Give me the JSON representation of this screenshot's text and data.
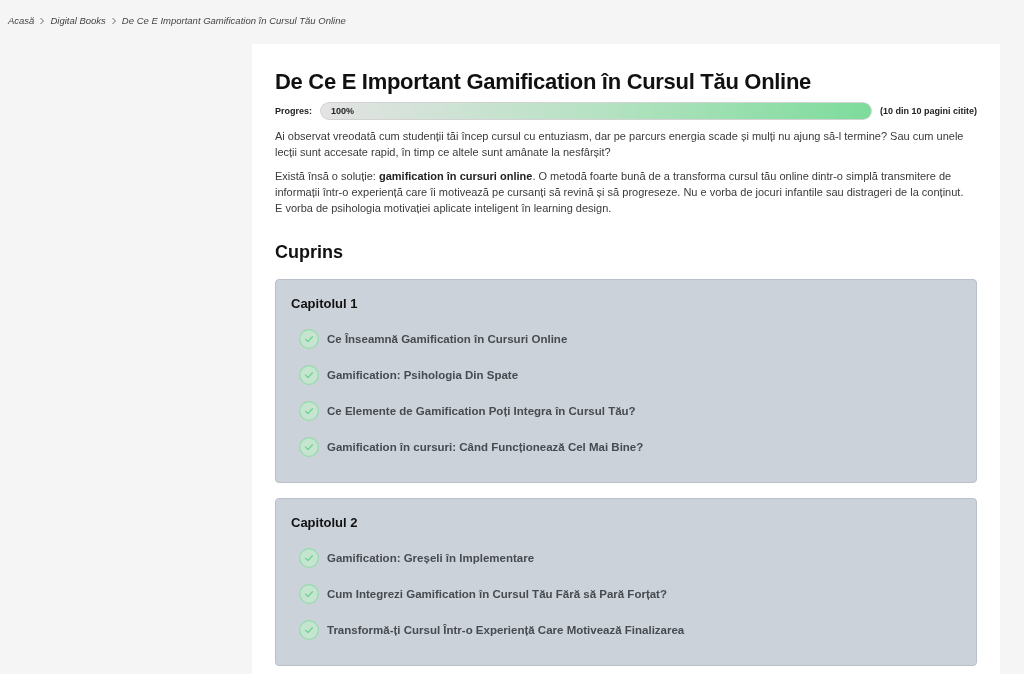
{
  "breadcrumb": [
    "Acasă",
    "Digital Books",
    "De Ce E Important Gamification în Cursul Tău Online"
  ],
  "title": "De Ce E Important Gamification în Cursul Tău Online",
  "progress": {
    "label": "Progres:",
    "value_text": "100%",
    "level": 1,
    "pages_text": "(10 din 10 pagini citite)"
  },
  "paragraphs": [
    "Ai observat vreodată cum studenții tăi încep cursul cu entuziasm, dar pe parcurs energia scade și mulți nu ajung să-l termine? Sau cum unele lecții sunt accesate rapid, în timp ce altele sunt amânate la nesfârșit?",
    "Există însă o soluție: **gamification în cursuri online**. O metodă foarte bună de a transforma cursul tău online dintr-o simplă transmitere de informații într-o experiență care îi motivează pe cursanți să revină și să progreseze. Nu e vorba de jocuri infantile sau distrageri de la conținut. E vorba de psihologia motivației aplicate inteligent în learning design."
  ],
  "contents": {
    "heading": "Cuprins",
    "chapters": [
      {
        "title": "Capitolul 1",
        "lessons": [
          {
            "title": "Ce Înseamnă Gamification în Cursuri Online",
            "completed": true
          },
          {
            "title": "Gamification: Psihologia Din Spate",
            "completed": true
          },
          {
            "title": "Ce Elemente de Gamification Poți Integra în Cursul Tău?",
            "completed": true
          },
          {
            "title": "Gamification în cursuri: Când Funcționează Cel Mai Bine?",
            "completed": true
          }
        ]
      },
      {
        "title": "Capitolul 2",
        "lessons": [
          {
            "title": "Gamification: Greșeli în Implementare",
            "completed": true
          },
          {
            "title": "Cum Integrezi Gamification în Cursul Tău Fără să Pară Forțat?",
            "completed": true
          },
          {
            "title": "Transformă-ți Cursul Într-o Experiență Care Motivează Finalizarea",
            "completed": true
          }
        ]
      }
    ]
  }
}
